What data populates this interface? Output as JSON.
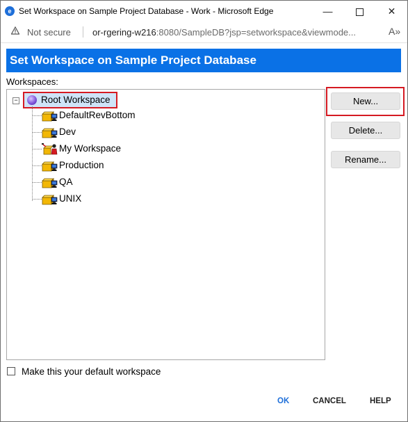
{
  "window": {
    "title": "Set Workspace on Sample Project Database - Work - Microsoft Edge",
    "minimize_glyph": "—",
    "close_glyph": "✕"
  },
  "addressbar": {
    "security": "Not secure",
    "url_host": "or-rgering-w216",
    "url_rest": ":8080/SampleDB?jsp=setworkspace&viewmode...",
    "read_aloud_glyph": "A»"
  },
  "dialog": {
    "title": "Set Workspace on Sample Project Database",
    "header_color": "#0a71e6",
    "workspaces_label": "Workspaces:",
    "tree": {
      "expander_glyph": "−",
      "root": {
        "label": "Root Workspace",
        "icon": "root-workspace-icon",
        "selected": true
      },
      "children": [
        {
          "label": "DefaultRevBottom",
          "icon": "workspace-icon"
        },
        {
          "label": "Dev",
          "icon": "workspace-icon"
        },
        {
          "label": "My Workspace",
          "icon": "my-workspace-icon"
        },
        {
          "label": "Production",
          "icon": "workspace-icon"
        },
        {
          "label": "QA",
          "icon": "workspace-icon"
        },
        {
          "label": "UNIX",
          "icon": "workspace-icon"
        }
      ]
    },
    "buttons": {
      "new": "New...",
      "delete": "Delete...",
      "rename": "Rename..."
    },
    "default_checkbox": {
      "label": "Make this your default workspace",
      "checked": false
    },
    "footer": {
      "ok": "OK",
      "cancel": "CANCEL",
      "help": "HELP"
    },
    "highlight_color": "#d51a22"
  }
}
